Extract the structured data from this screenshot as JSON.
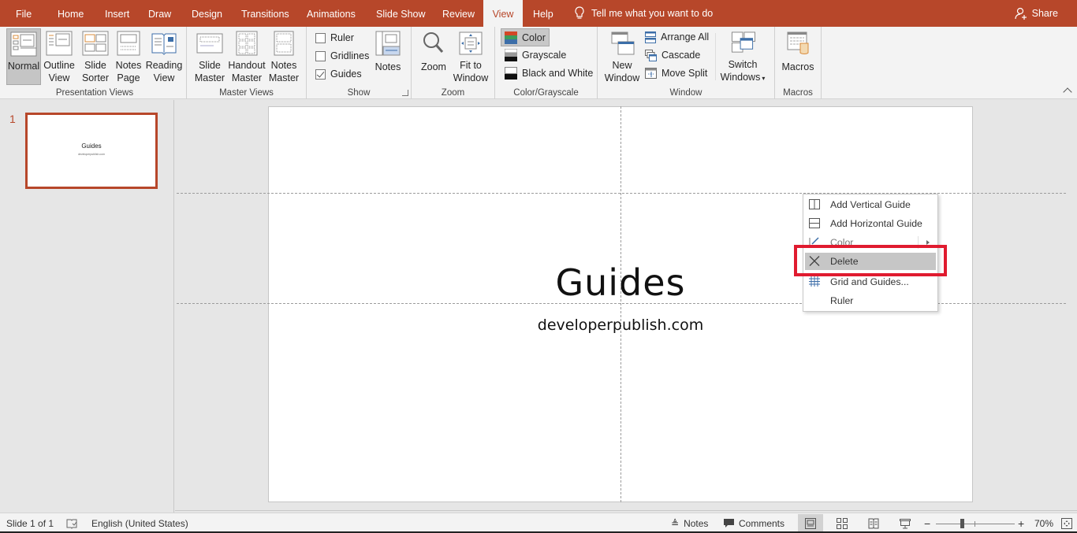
{
  "app": {
    "tabs": [
      {
        "label": "File"
      },
      {
        "label": "Home"
      },
      {
        "label": "Insert"
      },
      {
        "label": "Draw"
      },
      {
        "label": "Design"
      },
      {
        "label": "Transitions"
      },
      {
        "label": "Animations"
      },
      {
        "label": "Slide Show"
      },
      {
        "label": "Review"
      },
      {
        "label": "View"
      },
      {
        "label": "Help"
      }
    ],
    "active_tab": "View",
    "tell_me": "Tell me what you want to do",
    "share": "Share",
    "accent_color": "#b7472a"
  },
  "ribbon": {
    "presentation_views": {
      "label": "Presentation Views",
      "normal": "Normal",
      "outline_1": "Outline",
      "outline_2": "View",
      "sorter_1": "Slide",
      "sorter_2": "Sorter",
      "notes_page_1": "Notes",
      "notes_page_2": "Page",
      "reading_1": "Reading",
      "reading_2": "View"
    },
    "master_views": {
      "label": "Master Views",
      "slide_1": "Slide",
      "slide_2": "Master",
      "handout_1": "Handout",
      "handout_2": "Master",
      "notes_1": "Notes",
      "notes_2": "Master"
    },
    "show": {
      "label": "Show",
      "ruler": "Ruler",
      "ruler_checked": false,
      "gridlines": "Gridlines",
      "gridlines_checked": false,
      "guides": "Guides",
      "guides_checked": true,
      "notes": "Notes"
    },
    "zoom": {
      "label": "Zoom",
      "zoom": "Zoom",
      "fit_1": "Fit to",
      "fit_2": "Window"
    },
    "color_grayscale": {
      "label": "Color/Grayscale",
      "color": "Color",
      "grayscale": "Grayscale",
      "bw": "Black and White"
    },
    "window": {
      "label": "Window",
      "new_1": "New",
      "new_2": "Window",
      "arrange_all": "Arrange All",
      "cascade": "Cascade",
      "move_split": "Move Split",
      "switch_1": "Switch",
      "switch_2": "Windows"
    },
    "macros": {
      "label": "Macros",
      "macros": "Macros"
    }
  },
  "thumbnails": [
    {
      "number": "1",
      "title": "Guides",
      "subtitle": "developerpublish.com"
    }
  ],
  "slide": {
    "title": "Guides",
    "subtitle": "developerpublish.com"
  },
  "context_menu": {
    "items": [
      {
        "label": "Add Vertical Guide",
        "icon": "vertical-guide-icon"
      },
      {
        "label": "Add Horizontal Guide",
        "icon": "horizontal-guide-icon"
      },
      {
        "label": "Color",
        "icon": "pencil-icon",
        "submenu": true
      },
      {
        "label": "Delete",
        "icon": "x-icon",
        "highlighted": true
      },
      {
        "label": "Grid and Guides...",
        "icon": "grid-icon"
      },
      {
        "label": "Ruler",
        "icon": ""
      }
    ],
    "highlight_color": "#e01b2f"
  },
  "status": {
    "slide_info": "Slide 1 of 1",
    "language": "English (United States)",
    "notes": "Notes",
    "comments": "Comments",
    "zoom_minus": "−",
    "zoom_plus": "+",
    "zoom_level": "70%",
    "zoom_percent": 70
  }
}
